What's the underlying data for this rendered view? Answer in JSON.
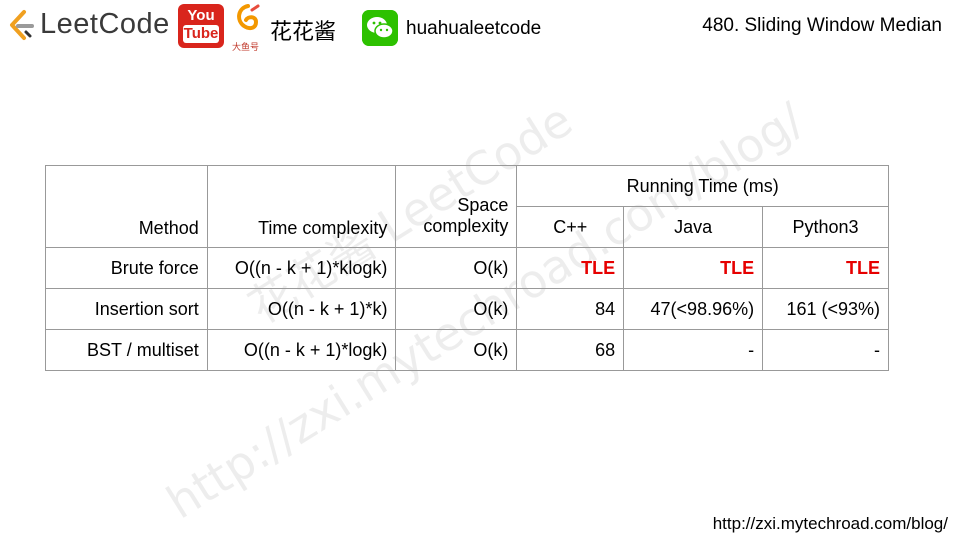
{
  "header": {
    "brand": "LeetCode",
    "youtube_top": "You",
    "youtube_bottom": "Tube",
    "fish_label": "大鱼号",
    "cn_name": "花花酱",
    "wechat_handle": "huahualeetcode",
    "title": "480. Sliding Window Median"
  },
  "watermark": {
    "line1": "花花酱 LeetCode",
    "line2": "http://zxi.mytechroad.com/blog/"
  },
  "table": {
    "headers": {
      "method": "Method",
      "time": "Time complexity",
      "space_line1": "Space",
      "space_line2": "complexity",
      "running": "Running Time (ms)",
      "cpp": "C++",
      "java": "Java",
      "python": "Python3"
    },
    "rows": [
      {
        "method": "Brute force",
        "time": "O((n - k + 1)*klogk)",
        "space": "O(k)",
        "cpp": "TLE",
        "java": "TLE",
        "python": "TLE"
      },
      {
        "method": "Insertion sort",
        "time": "O((n - k + 1)*k)",
        "space": "O(k)",
        "cpp": "84",
        "java": "47(<98.96%)",
        "python": "161 (<93%)"
      },
      {
        "method": "BST / multiset",
        "time": "O((n - k + 1)*logk)",
        "space": "O(k)",
        "cpp": "68",
        "java": "-",
        "python": "-"
      }
    ]
  },
  "footer": {
    "url": "http://zxi.mytechroad.com/blog/"
  },
  "colors": {
    "tle": "#e60000",
    "youtube": "#d9251c",
    "wechat": "#2dc100"
  }
}
